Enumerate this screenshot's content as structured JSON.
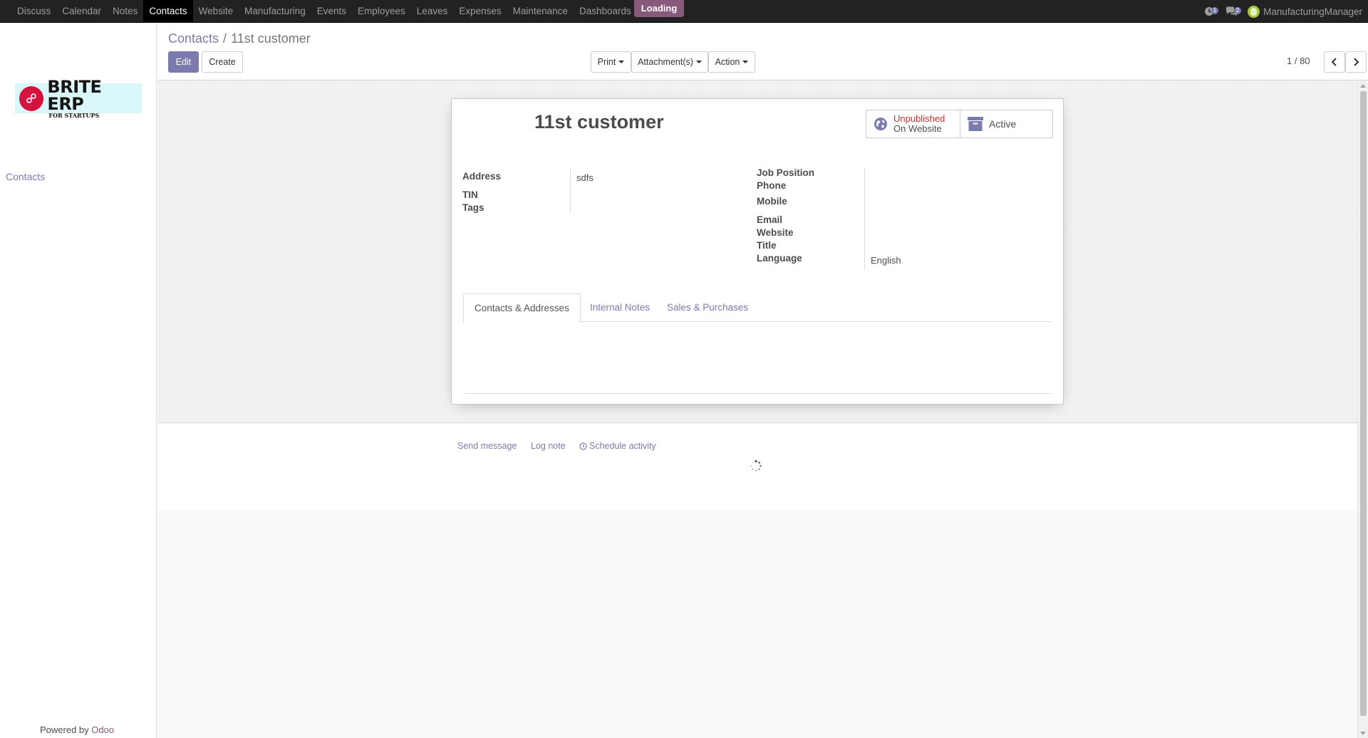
{
  "topnav": {
    "menu": [
      {
        "label": "Discuss",
        "active": false
      },
      {
        "label": "Calendar",
        "active": false
      },
      {
        "label": "Notes",
        "active": false
      },
      {
        "label": "Contacts",
        "active": true
      },
      {
        "label": "Website",
        "active": false
      },
      {
        "label": "Manufacturing",
        "active": false
      },
      {
        "label": "Events",
        "active": false
      },
      {
        "label": "Employees",
        "active": false
      },
      {
        "label": "Leaves",
        "active": false
      },
      {
        "label": "Expenses",
        "active": false
      },
      {
        "label": "Maintenance",
        "active": false
      },
      {
        "label": "Dashboards",
        "active": false
      }
    ],
    "loading": "Loading",
    "activity_count": "1",
    "messages_count": "2",
    "user": "ManufacturingManager"
  },
  "sidebar": {
    "logo_main": "BRITE ERP",
    "logo_sub": "FOR STARTUPS",
    "link": "Contacts",
    "powered_by": "Powered by",
    "odoo": "Odoo"
  },
  "control": {
    "breadcrumb_parent": "Contacts",
    "breadcrumb_sep": "/",
    "breadcrumb_current": "11st customer",
    "edit": "Edit",
    "create": "Create",
    "print": "Print",
    "attachments": "Attachment(s)",
    "action": "Action",
    "pager": "1 / 80"
  },
  "form": {
    "name": "11st customer",
    "website_status": "Unpublished",
    "website_label": "On Website",
    "active_label": "Active",
    "labels": {
      "address": "Address",
      "tin": "TIN",
      "tags": "Tags",
      "job_position": "Job Position",
      "phone": "Phone",
      "mobile": "Mobile",
      "email": "Email",
      "website": "Website",
      "title": "Title",
      "language": "Language"
    },
    "values": {
      "address": "sdfs",
      "language": "English"
    },
    "tabs": [
      "Contacts & Addresses",
      "Internal Notes",
      "Sales & Purchases"
    ],
    "active_tab": 0
  },
  "chatter": {
    "send_message": "Send message",
    "log_note": "Log note",
    "schedule_activity": "Schedule activity"
  },
  "colors": {
    "brand": "#875a7b",
    "primary": "#7c7bad",
    "danger": "#c9302c"
  }
}
